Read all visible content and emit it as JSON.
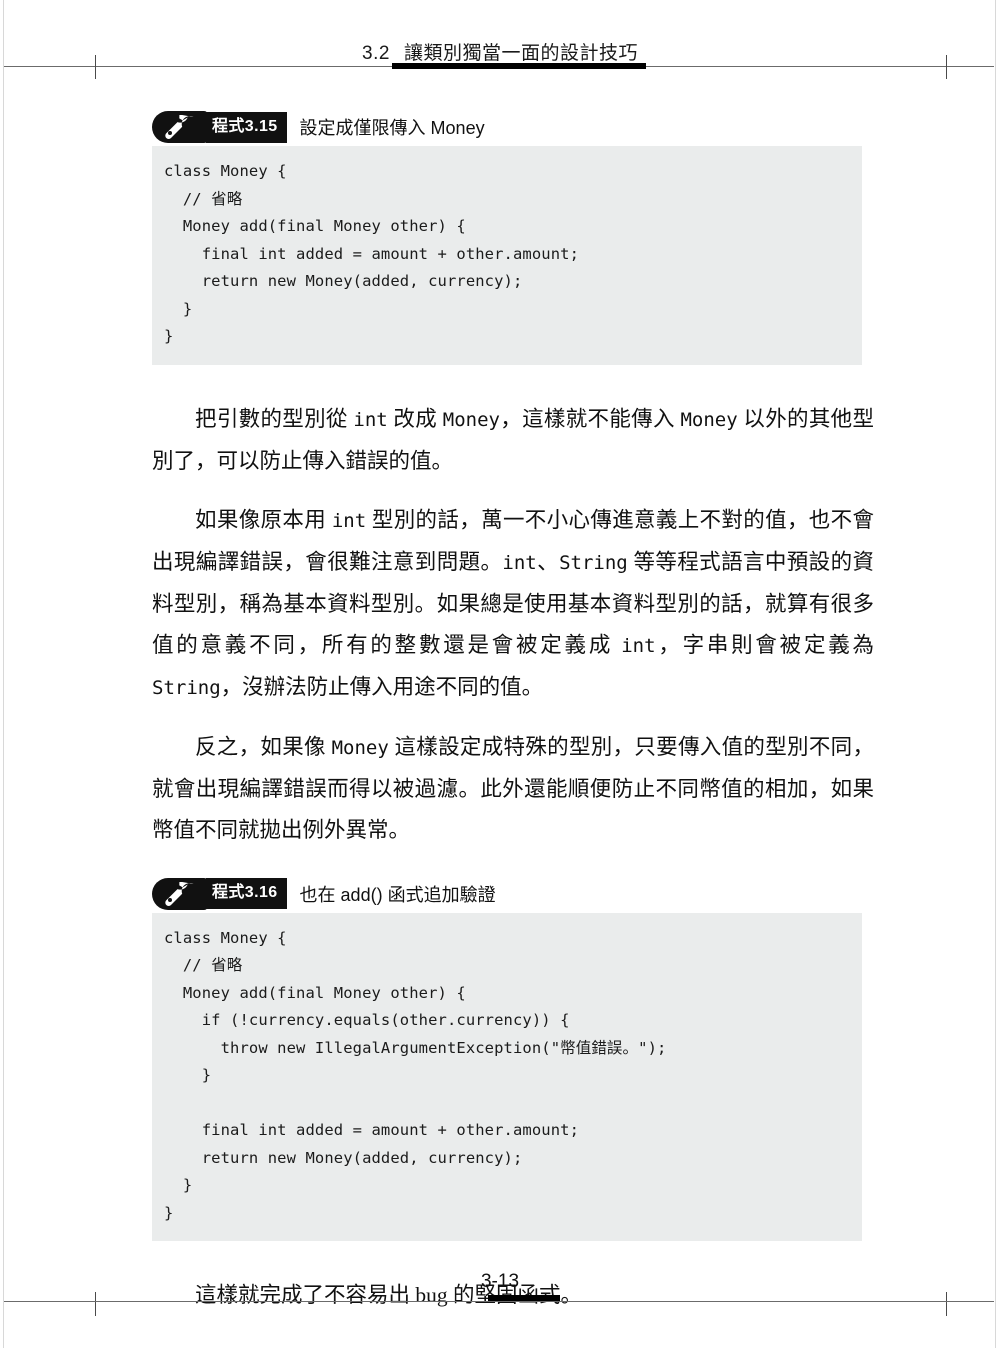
{
  "header": {
    "section_number": "3.2",
    "section_title": "讓類別獨當一面的設計技巧"
  },
  "footer": {
    "page_number": "3-13"
  },
  "listing_1": {
    "icon": "wrench-icon",
    "tag": "程式3.15",
    "title": "設定成僅限傳入 Money",
    "code": "class Money {\n  // 省略\n  Money add(final Money other) {\n    final int added = amount + other.amount;\n    return new Money(added, currency);\n  }\n}"
  },
  "listing_2": {
    "icon": "wrench-icon",
    "tag": "程式3.16",
    "title": "也在 add() 函式追加驗證",
    "code": "class Money {\n  // 省略\n  Money add(final Money other) {\n    if (!currency.equals(other.currency)) {\n      throw new IllegalArgumentException(\"幣值錯誤。\");\n    }\n\n    final int added = amount + other.amount;\n    return new Money(added, currency);\n  }\n}"
  },
  "paragraphs": {
    "p1_a": "把引數的型別從 ",
    "p1_code1": "int",
    "p1_b": " 改成 ",
    "p1_code2": "Money",
    "p1_c": "，這樣就不能傳入 ",
    "p1_code3": "Money",
    "p1_d": " 以外的其他型別了，可以防止傳入錯誤的值。",
    "p2_a": "如果像原本用 ",
    "p2_code1": "int",
    "p2_b": " 型別的話，萬一不小心傳進意義上不對的值，也不會出現編譯錯誤，會很難注意到問題。",
    "p2_code2": "int",
    "p2_c": "、",
    "p2_code3": "String",
    "p2_d": " 等等程式語言中預設的資料型別，稱為基本資料型別。如果總是使用基本資料型別的話，就算有很多值的意義不同，所有的整數還是會被定義成 ",
    "p2_code4": "int",
    "p2_e": "，字串則會被定義為 ",
    "p2_code5": "String",
    "p2_f": "，沒辦法防止傳入用途不同的值。",
    "p3_a": "反之，如果像 ",
    "p3_code1": "Money",
    "p3_b": " 這樣設定成特殊的型別，只要傳入值的型別不同，就會出現編譯錯誤而得以被過濾。此外還能順便防止不同幣值的相加，如果幣值不同就拋出例外異常。",
    "p4_a": "這樣就完成了不容易出 ",
    "p4_b": "bug",
    "p4_c": " 的堅固函式。"
  }
}
